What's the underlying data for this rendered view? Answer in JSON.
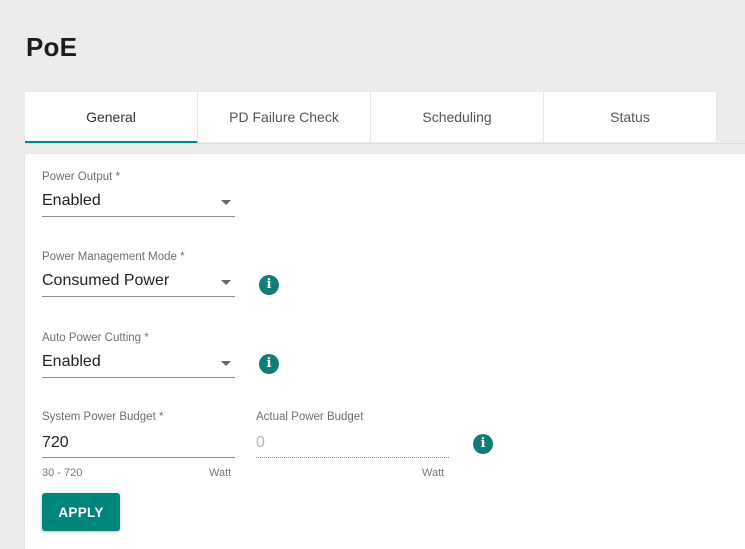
{
  "page": {
    "title": "PoE"
  },
  "tabs": [
    {
      "label": "General",
      "active": true
    },
    {
      "label": "PD Failure Check",
      "active": false
    },
    {
      "label": "Scheduling",
      "active": false
    },
    {
      "label": "Status",
      "active": false
    }
  ],
  "form": {
    "power_output": {
      "label": "Power Output *",
      "value": "Enabled"
    },
    "power_management_mode": {
      "label": "Power Management Mode *",
      "value": "Consumed Power",
      "info_icon": "info-icon"
    },
    "auto_power_cutting": {
      "label": "Auto Power Cutting *",
      "value": "Enabled",
      "info_icon": "info-icon"
    },
    "system_power_budget": {
      "label": "System Power Budget *",
      "value": "720",
      "range_hint": "30 - 720",
      "unit": "Watt"
    },
    "actual_power_budget": {
      "label": "Actual Power Budget",
      "value": "0",
      "unit": "Watt",
      "info_icon": "info-icon"
    },
    "apply_label": "APPLY"
  },
  "colors": {
    "accent": "#008787",
    "button": "#00857c",
    "info_icon": "#0f7f76"
  }
}
